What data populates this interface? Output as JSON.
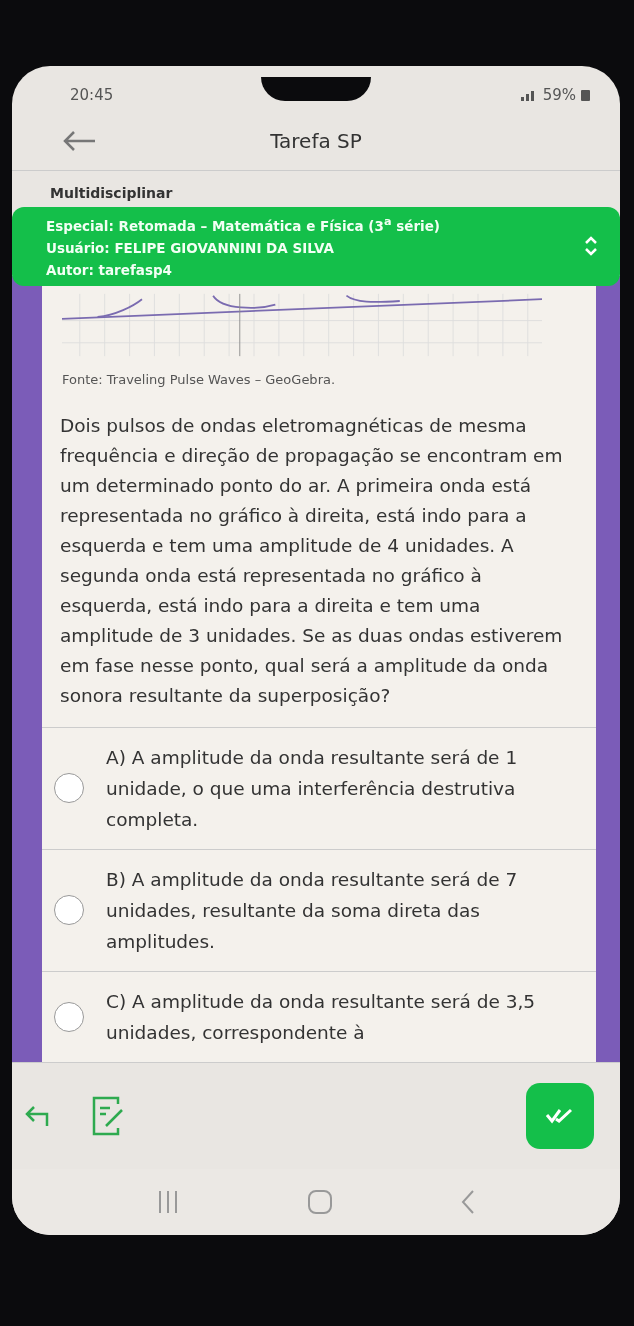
{
  "status_bar": {
    "time": "20:45",
    "battery": "59%"
  },
  "header": {
    "title": "Tarefa SP"
  },
  "banner": {
    "category": "Multidisciplinar",
    "special": "Especial: Retomada – Matemática e Física (3$^{a}$ série)",
    "user": "Usuário: FELIPE GIOVANNINI DA SILVA",
    "author": "Autor: tarefasp4"
  },
  "content": {
    "source": "Fonte: Traveling Pulse Waves – GeoGebra.",
    "question": "Dois pulsos de ondas eletromagnéticas de mesma frequência e direção de propagação se encontram em um determinado ponto do ar. A primeira onda está representada no gráfico à direita, está indo para a esquerda e tem uma amplitude de 4 unidades. A segunda onda está representada no gráfico à esquerda, está indo para a direita e tem uma amplitude de 3 unidades. Se as duas ondas estiverem em fase nesse ponto, qual será a amplitude da onda sonora resultante da superposição?",
    "options": [
      {
        "text": "A) A amplitude da onda resultante será de 1 unidade, o que uma interferência destrutiva completa.",
        "selected": false
      },
      {
        "text": "B) A amplitude da onda resultante será de 7 unidades, resultante da soma direta das amplitudes.",
        "selected": false
      },
      {
        "text": "C) A amplitude da onda resultante será de 3,5 unidades, correspondente à",
        "selected": false
      }
    ]
  }
}
